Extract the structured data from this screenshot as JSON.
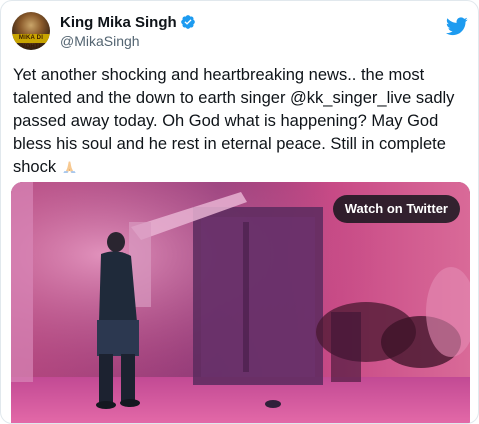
{
  "author": {
    "display_name": "King Mika Singh",
    "handle": "@MikaSingh",
    "avatar_text": "MIKA DI VOHTI",
    "verified": true,
    "avatar_icon": "profile-photo",
    "verified_icon": "verified-badge-icon"
  },
  "brand": {
    "icon": "twitter-bird-icon",
    "color": "#1d9bf0"
  },
  "tweet": {
    "text": "Yet another shocking and heartbreaking news.. the most talented and the down to earth singer @kk_singer_live sadly passed away today. Oh God what is happening? May God bless his soul and he rest in eternal peace. Still in complete shock",
    "emoji": "folded-hands-emoji"
  },
  "media": {
    "watch_label": "Watch on Twitter",
    "tint_color": "#c2408a"
  }
}
